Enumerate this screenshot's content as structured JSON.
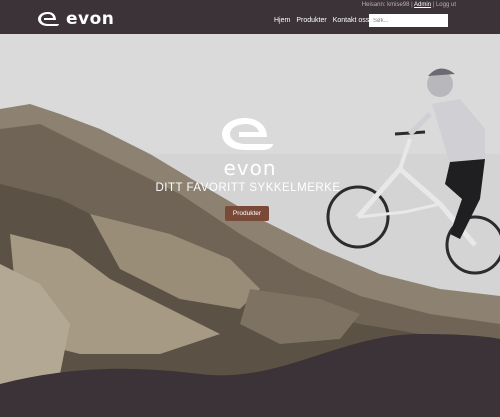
{
  "header": {
    "brand_name": "evon",
    "user_strip": {
      "prefix": "Heisann: kmise98 |",
      "admin_label": "Admin",
      "separator": "|",
      "logout_label": "Logg ut"
    },
    "nav": [
      "Hjem",
      "Produkter",
      "Kontakt oss"
    ],
    "search": {
      "placeholder": "Søk...",
      "value": ""
    }
  },
  "hero": {
    "brand_name": "evon",
    "tagline": "DITT FAVORITT SYKKELMERKE",
    "button_label": "Produkter"
  },
  "colors": {
    "header_bg": "#3b3338",
    "footer_wave": "#3b3338",
    "button_bg": "#7a4a38",
    "text": "#ffffff"
  }
}
